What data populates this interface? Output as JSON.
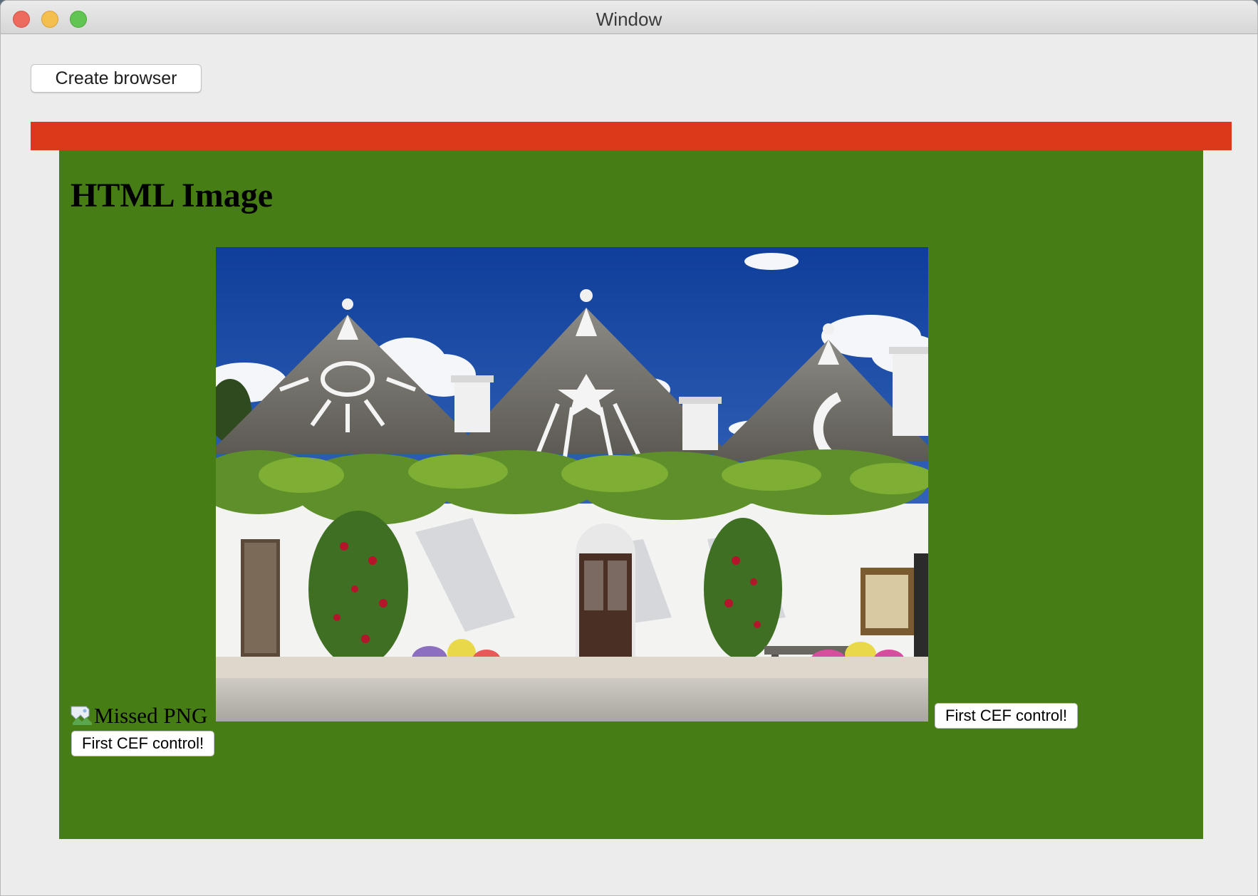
{
  "window": {
    "title": "Window",
    "controls": [
      "close",
      "minimize",
      "zoom"
    ]
  },
  "toolbar": {
    "create_browser_label": "Create browser"
  },
  "page": {
    "heading": "HTML Image",
    "missing_image_alt": "Missed PNG",
    "cef_button_1_label": "First CEF control!",
    "cef_button_2_label": "First CEF control!",
    "colors": {
      "header_bar": "#dc391a",
      "panel_background": "#477d15"
    }
  },
  "photo": {
    "subject": "trulli houses with conical stone roofs under a blue sky"
  }
}
